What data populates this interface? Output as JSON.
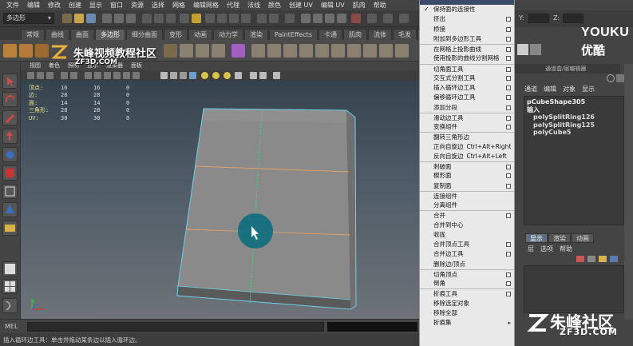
{
  "menubar": [
    "文件",
    "编辑",
    "修改",
    "创建",
    "显示",
    "窗口",
    "资源",
    "选择",
    "网格",
    "编辑网格",
    "代理",
    "法线",
    "颜色",
    "创建 UV",
    "编辑 UV",
    "肌肉",
    "帮助"
  ],
  "status": {
    "mode": "多边形",
    "coord_y": "Y:",
    "coord_z": "Z:"
  },
  "shelf_tabs": [
    "常规",
    "曲线",
    "曲面",
    "多边形",
    "细分曲面",
    "变形",
    "动画",
    "动力学",
    "渲染",
    "PaintEffects",
    "卡通",
    "肌肉",
    "流体",
    "毛发",
    "头发"
  ],
  "shelf_active": "多边形",
  "viewport": {
    "menu": [
      "视图",
      "着色",
      "照明",
      "显示",
      "渲染器",
      "面板"
    ],
    "hud_rows": [
      {
        "label": "顶点:",
        "a": "16",
        "b": "16",
        "c": "0"
      },
      {
        "label": "边:",
        "a": "28",
        "b": "28",
        "c": "0"
      },
      {
        "label": "面:",
        "a": "14",
        "b": "14",
        "c": "0"
      },
      {
        "label": "三角形:",
        "a": "28",
        "b": "28",
        "c": "0"
      },
      {
        "label": "UV:",
        "a": "30",
        "b": "30",
        "c": "0"
      }
    ],
    "watermark": "朱峰视频教程社区",
    "watermark_sub": "ZF3D.COM",
    "axis": "x"
  },
  "cmdline": {
    "label": "MEL",
    "help": "插入循环边工具：单击并拖动某条边以插入循环边。"
  },
  "channelbox": {
    "title": "通道盒/层编辑器",
    "menu": [
      "通道",
      "编辑",
      "对象",
      "显示"
    ],
    "node": "pCubeShape305",
    "inputs_label": "输入",
    "inputs": [
      "polySplitRing126",
      "polySplitRing125",
      "polyCube5"
    ]
  },
  "layers": {
    "tabs": [
      "显示",
      "渲染",
      "动画"
    ],
    "active_tab": "显示",
    "menu": [
      "层",
      "选项",
      "帮助"
    ]
  },
  "branding": {
    "youku_en": "YOUKU",
    "youku_cn": "优酷",
    "bottom_cn": "朱峰社区",
    "bottom_en": "ZF3D.COM"
  },
  "context_menu": {
    "items": [
      {
        "label": "保持面的连接性",
        "check": true
      },
      {
        "label": "挤出",
        "opt": true
      },
      {
        "label": "桥接",
        "opt": true
      },
      {
        "label": "附加到多边形工具",
        "opt": true
      },
      {
        "label": "在网格上投影曲线",
        "opt": true,
        "divider": true
      },
      {
        "label": "使用投影的曲线分割网格",
        "opt": true
      },
      {
        "label": "切角面工具",
        "opt": true,
        "divider": true
      },
      {
        "label": "交互式分割工具",
        "opt": true
      },
      {
        "label": "插入循环边工具",
        "opt": true
      },
      {
        "label": "偏移循环边工具",
        "opt": true
      },
      {
        "label": "添加分段",
        "opt": true
      },
      {
        "label": "滑动边工具",
        "opt": true,
        "divider": true
      },
      {
        "label": "变换组件",
        "opt": true
      },
      {
        "label": "翻转三角形边",
        "divider": true
      },
      {
        "label": "正向自旋边",
        "shortcut": "Ctrl+Alt+Right"
      },
      {
        "label": "反向自旋边",
        "shortcut": "Ctrl+Alt+Left"
      },
      {
        "label": "刺破面",
        "opt": true,
        "divider": true
      },
      {
        "label": "楔形面",
        "opt": true
      },
      {
        "label": "复制面",
        "opt": true
      },
      {
        "label": "连接组件",
        "divider": true
      },
      {
        "label": "分离组件"
      },
      {
        "label": "合并",
        "opt": true,
        "divider": true
      },
      {
        "label": "合并到中心"
      },
      {
        "label": "收拢"
      },
      {
        "label": "合并顶点工具",
        "opt": true
      },
      {
        "label": "合并边工具",
        "opt": true
      },
      {
        "label": "删除边/顶点"
      },
      {
        "label": "切角顶点",
        "opt": true,
        "divider": true
      },
      {
        "label": "倒角",
        "opt": true
      },
      {
        "label": "折痕工具",
        "opt": true,
        "divider": true
      },
      {
        "label": "移除选定对象"
      },
      {
        "label": "移除全部"
      },
      {
        "label": "折痕集",
        "arrow": true
      }
    ]
  }
}
